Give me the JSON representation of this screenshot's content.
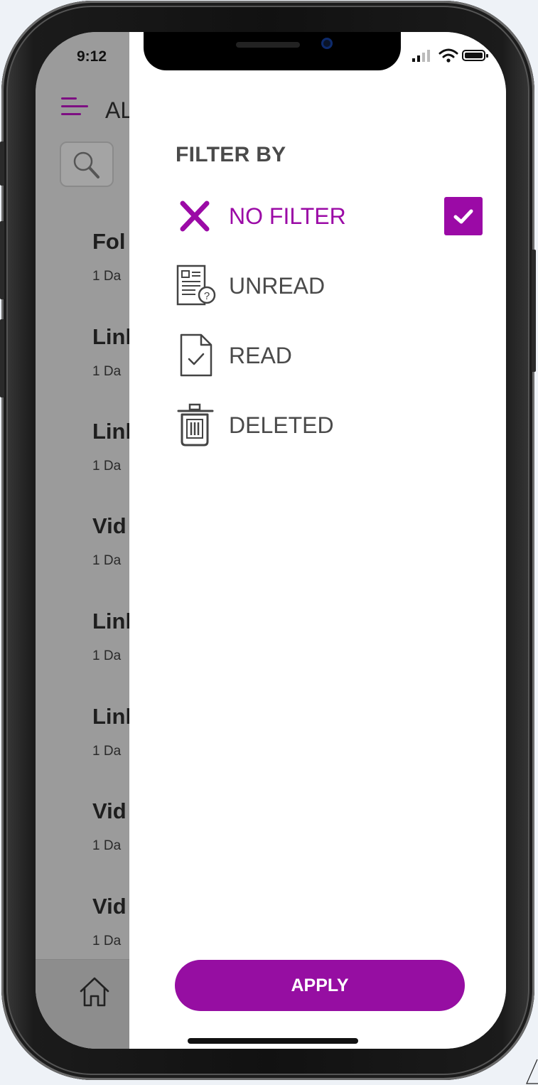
{
  "status_bar": {
    "time": "9:12"
  },
  "background_app": {
    "title": "AL",
    "items": [
      {
        "title": "Fol",
        "date": "1 Da"
      },
      {
        "title": "Linl",
        "date": "1 Da"
      },
      {
        "title": "Linl",
        "date": "1 Da"
      },
      {
        "title": "Vid",
        "date": "1 Da"
      },
      {
        "title": "Linl",
        "date": "1 Da"
      },
      {
        "title": "Linl",
        "date": "1 Da"
      },
      {
        "title": "Vid",
        "date": "1 Da"
      },
      {
        "title": "Vid",
        "date": "1 Da"
      }
    ]
  },
  "filter_panel": {
    "heading": "FILTER BY",
    "options": [
      {
        "label": "NO FILTER",
        "icon": "x-icon",
        "selected": true
      },
      {
        "label": "UNREAD",
        "icon": "unread-document-icon",
        "selected": false
      },
      {
        "label": "READ",
        "icon": "read-document-icon",
        "selected": false
      },
      {
        "label": "DELETED",
        "icon": "trash-icon",
        "selected": false
      }
    ],
    "apply_label": "APPLY"
  },
  "colors": {
    "accent": "#9b0aa6",
    "text": "#4a4a4a",
    "overlay": "#9b9b9b"
  }
}
